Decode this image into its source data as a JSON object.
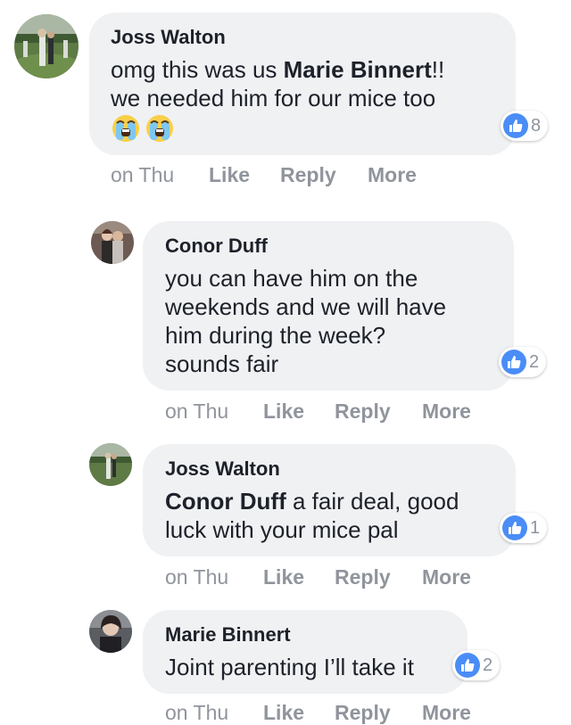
{
  "comments": [
    {
      "author": "Joss Walton",
      "lines": [
        {
          "mention": "",
          "text": "omg this was us "
        },
        {
          "mention": "",
          "text": "we needed him for our mice too"
        }
      ],
      "inline_mention": "Marie Binnert",
      "inline_after": "!!",
      "emojis": [
        "crying-face-icon",
        "crying-face-icon"
      ],
      "likes": "8",
      "time": "on Thu",
      "like_label": "Like",
      "reply_label": "Reply",
      "more_label": "More"
    },
    {
      "author": "Conor Duff",
      "lines": [
        "you can have him on the",
        "weekends and we will have",
        "him during the week?",
        "sounds fair"
      ],
      "likes": "2",
      "time": "on Thu",
      "like_label": "Like",
      "reply_label": "Reply",
      "more_label": "More"
    },
    {
      "author": "Joss Walton",
      "mention": "Conor Duff",
      "line1_rest": " a fair deal, good",
      "line2": "luck with your mice pal",
      "likes": "1",
      "time": "on Thu",
      "like_label": "Like",
      "reply_label": "Reply",
      "more_label": "More"
    },
    {
      "author": "Marie Binnert",
      "text": "Joint parenting I’ll take it",
      "likes": "2",
      "time": "on Thu",
      "like_label": "Like",
      "reply_label": "Reply",
      "more_label": "More"
    }
  ],
  "colors": {
    "bubble": "#f0f1f3",
    "like_blue": "#4a8df7",
    "meta_gray": "#90949c",
    "text": "#1d2129"
  }
}
